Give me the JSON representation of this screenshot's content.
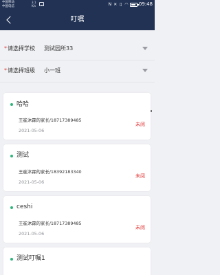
{
  "status_bar": {
    "carrier1": "中国移动",
    "carrier2": "中国电信",
    "network_speed": "3.1\nK/s",
    "time": "09:48",
    "icons": [
      "nfc-icon",
      "mute-icon",
      "vibrate-icon",
      "wifi-icon",
      "battery-icon"
    ]
  },
  "header": {
    "title": "叮嘱",
    "background": "#213254"
  },
  "filters": {
    "school_label": "请选择学校",
    "school_value": "测试园所33",
    "class_label": "请选择班级",
    "class_value": "小一班",
    "required_mark": "*"
  },
  "messages": [
    {
      "title": "哈哈",
      "sender": "王崔沐霖的家长/18717389485",
      "date": "2021-05-06",
      "status": "未阅"
    },
    {
      "title": "测试",
      "sender": "王崔沐霖的家长/18392183340",
      "date": "2021-05-06",
      "status": "未阅"
    },
    {
      "title": "ceshi",
      "sender": "王崔沐霖的家长/18717389485",
      "date": "2021-05-06",
      "status": "未阅"
    },
    {
      "title": "测试叮嘱1",
      "sender": "",
      "date": "",
      "status": ""
    }
  ],
  "colors": {
    "accent_dot": "#2fb57c",
    "unread": "#e33b3b",
    "background": "#f0f1f4"
  }
}
